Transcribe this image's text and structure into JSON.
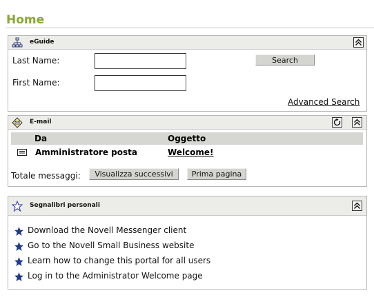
{
  "page": {
    "title": "Home"
  },
  "eguide": {
    "title": "eGuide",
    "last_name_label": "Last Name:",
    "first_name_label": "First Name:",
    "last_name_value": "",
    "first_name_value": "",
    "search_label": "Search",
    "advanced_search_label": "Advanced Search"
  },
  "email": {
    "title": "E-mail",
    "col_from": "Da",
    "col_subject": "Oggetto",
    "rows": [
      {
        "from": "Amministratore posta",
        "subject": "Welcome!"
      }
    ],
    "total_label": "Totale messaggi:",
    "next_label": "Visualizza successivi",
    "first_page_label": "Prima pagina"
  },
  "bookmarks": {
    "title": "Segnalibri personali",
    "items": [
      {
        "label": "Download the Novell Messenger client"
      },
      {
        "label": "Go to the Novell Small Business website"
      },
      {
        "label": "Learn how to change this portal for all users"
      },
      {
        "label": "Log in to the Administrator Welcome page"
      }
    ]
  },
  "colors": {
    "title_green": "#8aa833",
    "header_bg": "#ecece8",
    "star_blue": "#1e3c8c"
  },
  "icons": {
    "eguide": "org-chart-icon",
    "email": "mail-diamond-icon",
    "bookmarks": "star-outline-icon",
    "collapse": "collapse-up-icon",
    "refresh": "refresh-icon",
    "message": "envelope-icon",
    "bullet": "star-icon"
  }
}
